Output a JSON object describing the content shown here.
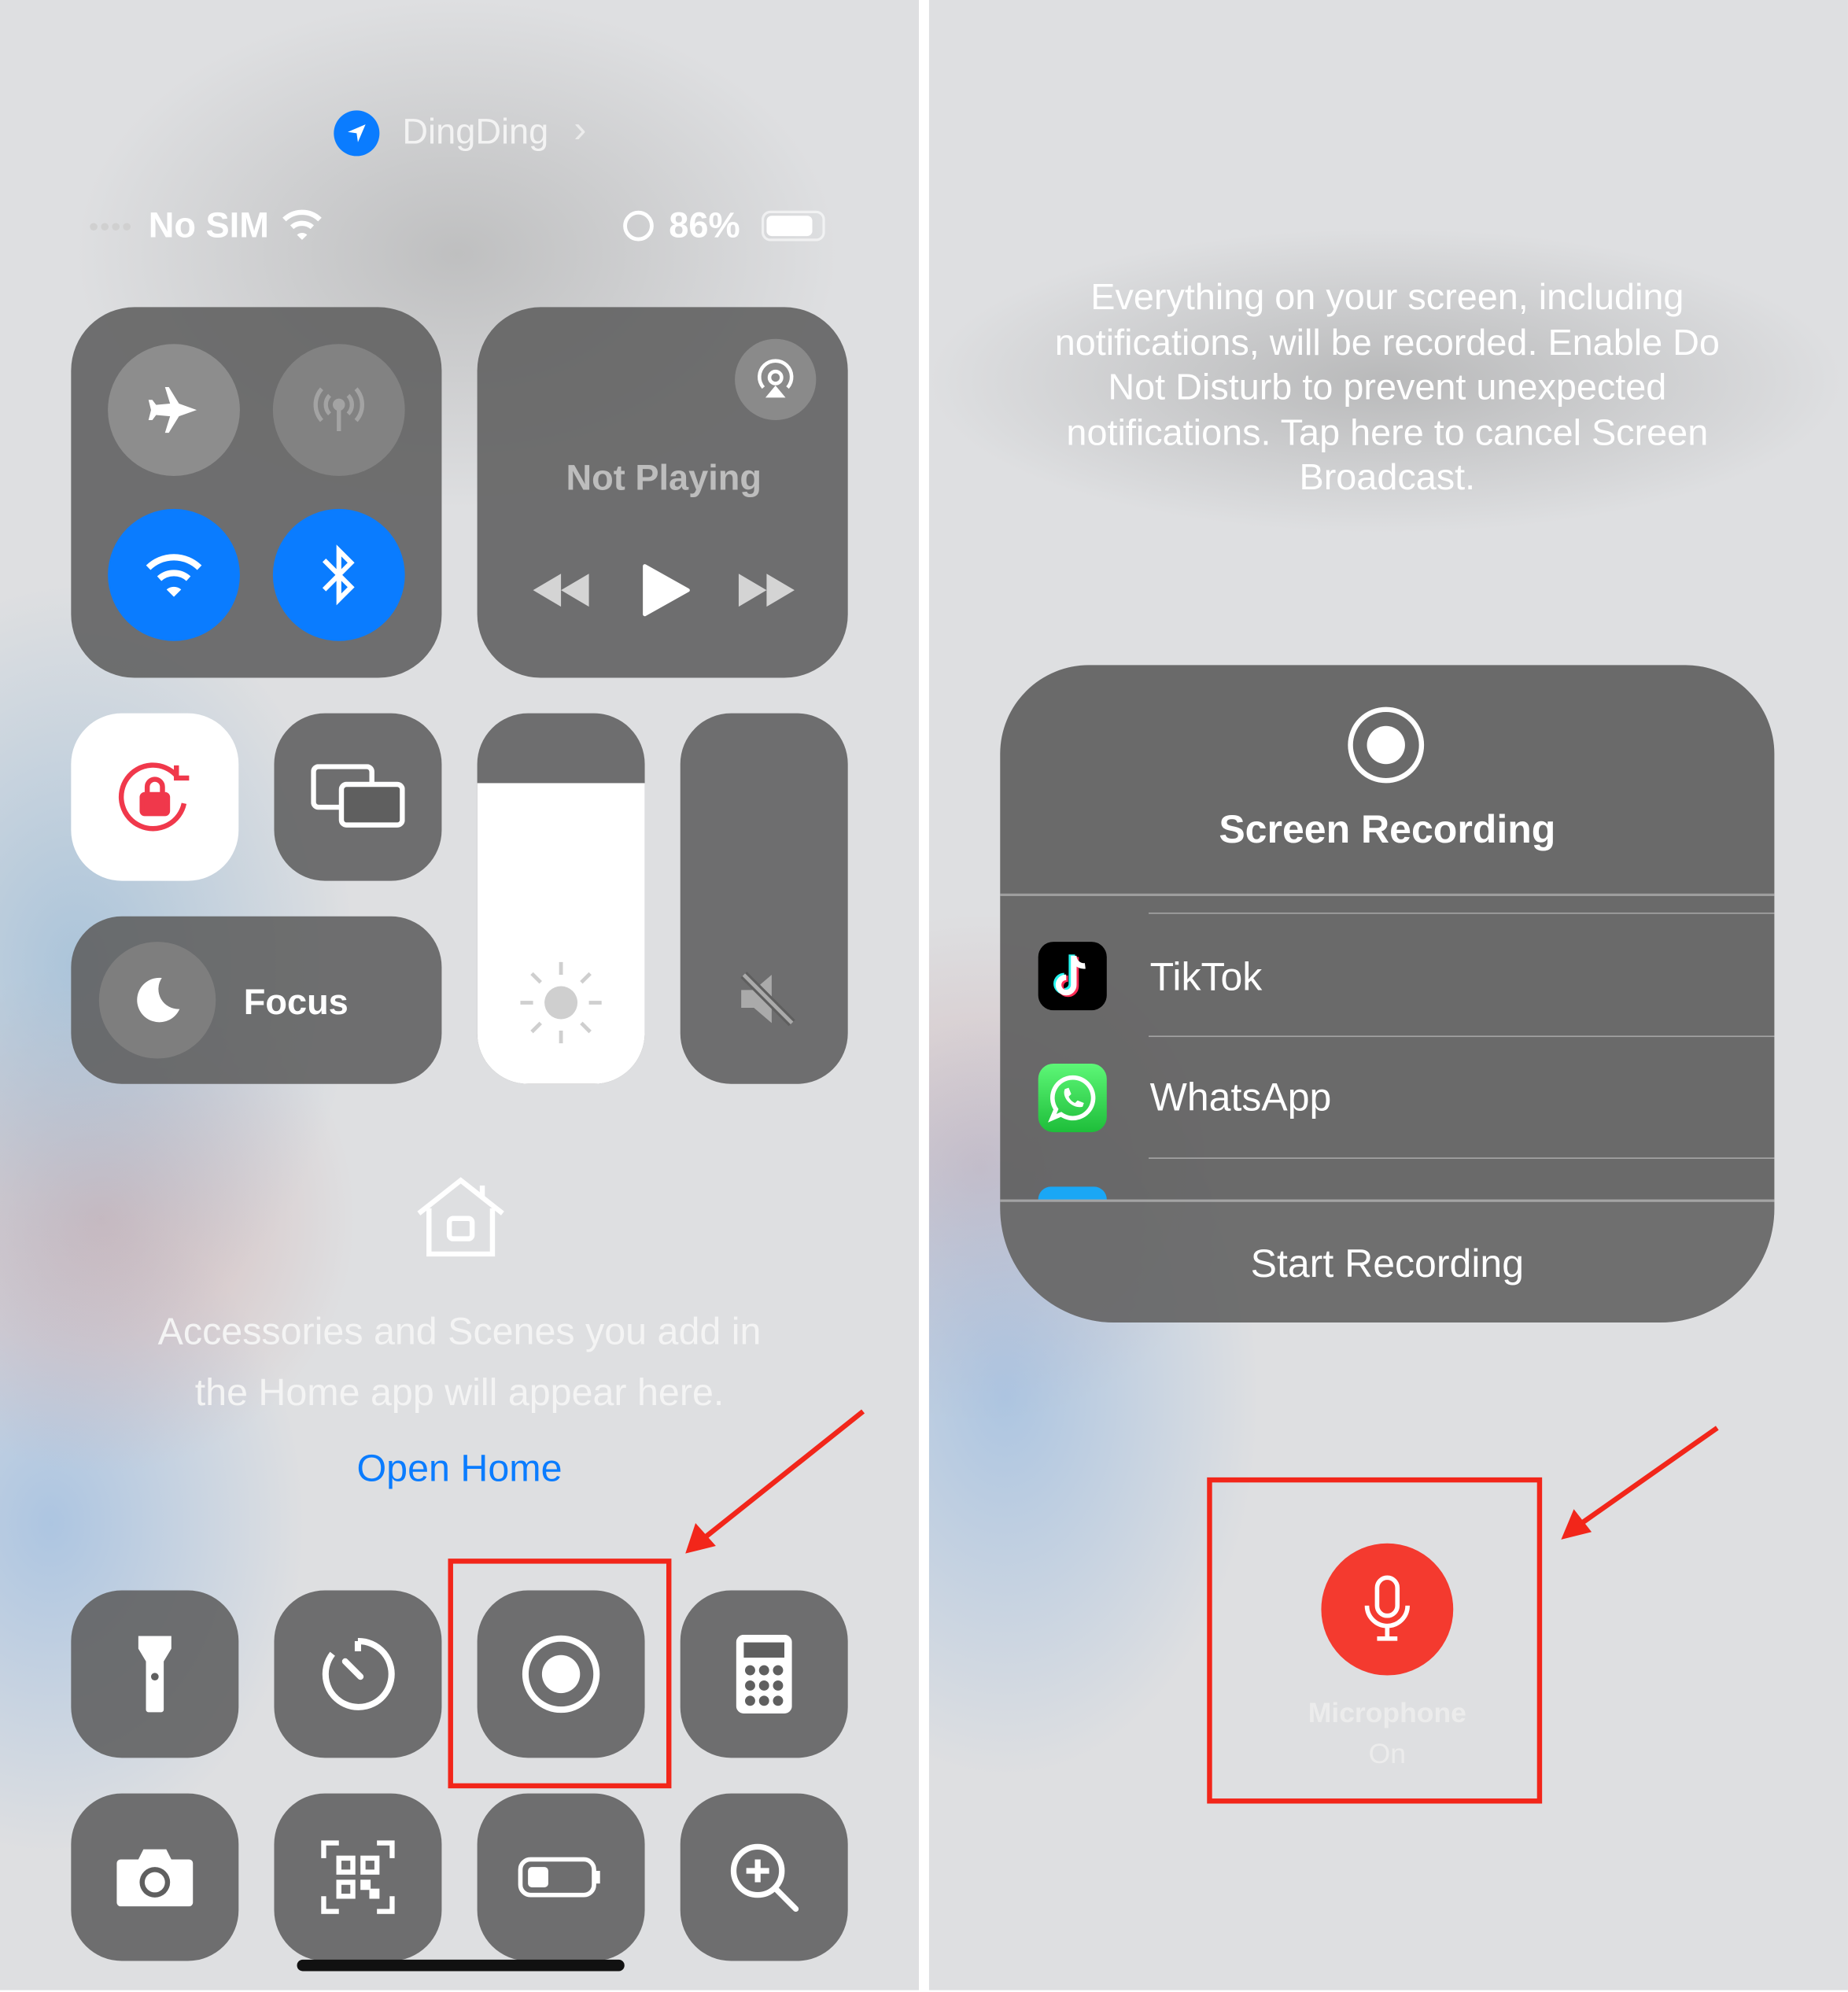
{
  "left": {
    "location_app": "DingDing",
    "status": {
      "carrier": "No SIM",
      "battery": "86%",
      "battery_level": 0.86
    },
    "media": {
      "title": "Not Playing"
    },
    "focus_label": "Focus",
    "brightness_level": 0.81,
    "volume_level": 0,
    "home": {
      "line1": "Accessories and Scenes you add in",
      "line2": "the Home app will appear here.",
      "link": "Open Home"
    },
    "accent": "#0a7cff",
    "icons": [
      "airplane-icon",
      "cellular-icon",
      "wifi-icon",
      "bluetooth-icon",
      "airplay-icon",
      "rewind-icon",
      "play-icon",
      "fast-forward-icon",
      "rotation-lock-icon",
      "screen-mirroring-icon",
      "brightness-icon",
      "mute-icon",
      "moon-icon",
      "home-icon",
      "flashlight-icon",
      "timer-icon",
      "screen-record-icon",
      "calculator-icon",
      "camera-icon",
      "qr-scanner-icon",
      "low-power-icon",
      "magnifier-icon"
    ]
  },
  "right": {
    "notice": [
      "Everything on your screen, including",
      "notifications, will be recorded. Enable Do",
      "Not Disturb to prevent unexpected",
      "notifications. Tap here to cancel Screen",
      "Broadcast."
    ],
    "sheet_title": "Screen Recording",
    "apps": [
      {
        "name": "TikTok"
      },
      {
        "name": "WhatsApp"
      }
    ],
    "start_label": "Start Recording",
    "mic": {
      "label": "Microphone",
      "state": "On",
      "color": "#f43a2f"
    }
  },
  "annotation_color": "#f2261a"
}
